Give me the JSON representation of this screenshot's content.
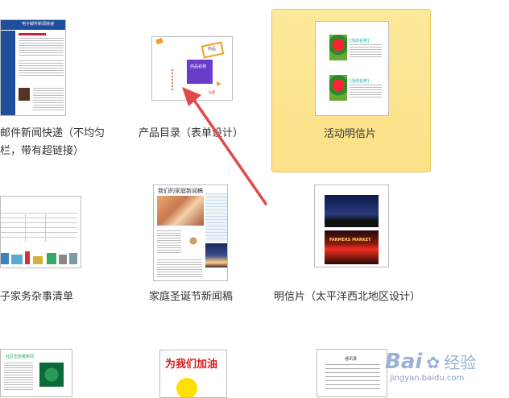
{
  "templates": [
    {
      "id": "email-news",
      "label_lines": [
        "邮件新闻快递（不均匀",
        "栏，带有超链接）"
      ],
      "thumb_title": "电子邮件新闻快递"
    },
    {
      "id": "product-catalog",
      "label_lines": [
        "产品目录（表单设计）"
      ],
      "thumb_texts": [
        "商品",
        "商品名称",
        "标题"
      ]
    },
    {
      "id": "event-postcard",
      "label_lines": [
        "活动明信片"
      ],
      "thumb_texts": [
        "[活动名称]",
        "[活动名称]"
      ],
      "selected": true
    },
    {
      "id": "family-chores",
      "label_lines": [
        "子家务杂事清单"
      ]
    },
    {
      "id": "christmas-news",
      "label_lines": [
        "家庭圣诞节新闻稿"
      ],
      "thumb_title": "我们的家庭新闻稿"
    },
    {
      "id": "pnw-postcard",
      "label_lines": [
        "明信片（太平洋西北地区设计）"
      ],
      "thumb_texts": [
        "FARMERS MARKET"
      ]
    },
    {
      "id": "volunteer-news",
      "label_lines": [],
      "thumb_title": "社区志愿者新闻"
    },
    {
      "id": "cheer-poster",
      "label_lines": [],
      "thumb_title": "为我们加油"
    },
    {
      "id": "address-list",
      "label_lines": [],
      "thumb_title": "通讯录"
    }
  ],
  "watermark": {
    "text": "Bai",
    "text2": "经验",
    "url": "jingyan.baidu.com"
  },
  "colors": {
    "selected_bg": "#fde99b",
    "arrow": "#e04a4a",
    "accent": "#3a5fa8"
  }
}
